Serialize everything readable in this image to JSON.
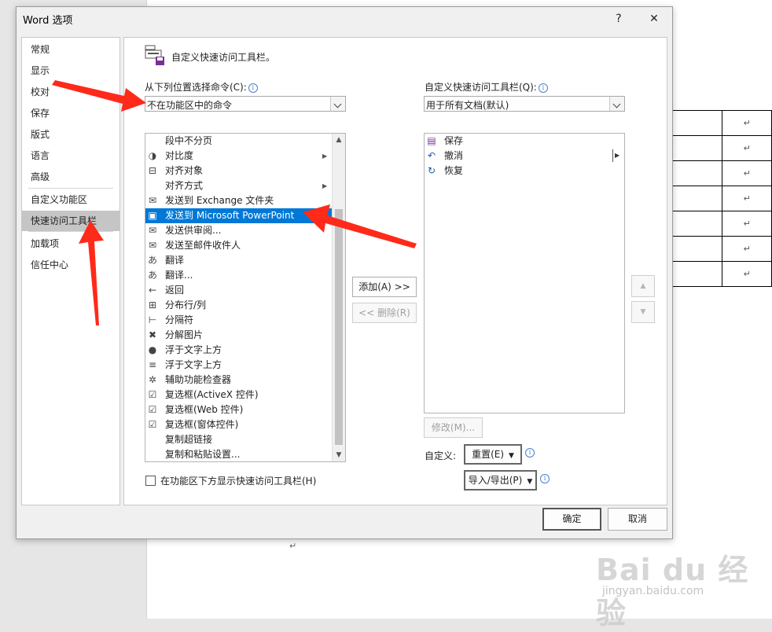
{
  "dialog": {
    "title": "Word 选项",
    "help": "?",
    "close": "✕"
  },
  "nav": {
    "items": [
      {
        "label": "常规"
      },
      {
        "label": "显示"
      },
      {
        "label": "校对"
      },
      {
        "label": "保存"
      },
      {
        "label": "版式"
      },
      {
        "label": "语言"
      },
      {
        "label": "高级"
      },
      {
        "label": "自定义功能区"
      },
      {
        "label": "快速访问工具栏",
        "selected": true
      },
      {
        "label": "加载项"
      },
      {
        "label": "信任中心"
      }
    ]
  },
  "section": {
    "title": "自定义快速访问工具栏。"
  },
  "commands": {
    "label": "从下列位置选择命令(C):",
    "selected": "不在功能区中的命令",
    "items": [
      {
        "label": "段中不分页",
        "icon": ""
      },
      {
        "label": "对比度",
        "icon": "contrast-icon",
        "glyph": "◑",
        "submenu": true
      },
      {
        "label": "对齐对象",
        "icon": "align-objects-icon",
        "glyph": "⊟"
      },
      {
        "label": "对齐方式",
        "icon": "",
        "submenu": true
      },
      {
        "label": "发送到 Exchange 文件夹",
        "icon": "exchange-folder-icon",
        "glyph": "✉"
      },
      {
        "label": "发送到 Microsoft PowerPoint",
        "icon": "powerpoint-icon",
        "glyph": "▣",
        "selected": true
      },
      {
        "label": "发送供审阅...",
        "icon": "send-review-icon",
        "glyph": "✉"
      },
      {
        "label": "发送至邮件收件人",
        "icon": "mail-recipient-icon",
        "glyph": "✉"
      },
      {
        "label": "翻译",
        "icon": "translate-icon",
        "glyph": "あ"
      },
      {
        "label": "翻译...",
        "icon": "translate-icon",
        "glyph": "あ"
      },
      {
        "label": "返回",
        "icon": "back-arrow-icon",
        "glyph": "←"
      },
      {
        "label": "分布行/列",
        "icon": "distribute-icon",
        "glyph": "⊞"
      },
      {
        "label": "分隔符",
        "icon": "separator-icon",
        "glyph": "⊢"
      },
      {
        "label": "分解图片",
        "icon": "ungroup-picture-icon",
        "glyph": "✖"
      },
      {
        "label": "浮于文字上方",
        "icon": "in-front-of-text-icon",
        "glyph": "●"
      },
      {
        "label": "浮于文字上方",
        "icon": "bring-forward-icon",
        "glyph": "≡"
      },
      {
        "label": "辅助功能检查器",
        "icon": "accessibility-icon",
        "glyph": "✲"
      },
      {
        "label": "复选框(ActiveX 控件)",
        "icon": "checkbox-icon",
        "glyph": "☑"
      },
      {
        "label": "复选框(Web 控件)",
        "icon": "checkbox-icon",
        "glyph": "☑"
      },
      {
        "label": "复选框(窗体控件)",
        "icon": "checkbox-icon",
        "glyph": "☑"
      },
      {
        "label": "复制超链接",
        "icon": ""
      },
      {
        "label": "复制和粘贴设置...",
        "icon": ""
      }
    ]
  },
  "toolbar_scope": {
    "label": "自定义快速访问工具栏(Q):",
    "selected": "用于所有文档(默认)"
  },
  "qat": {
    "items": [
      {
        "label": "保存",
        "icon": "save-icon",
        "glyph": "▤"
      },
      {
        "label": "撤消",
        "icon": "undo-icon",
        "glyph": "↶"
      },
      {
        "label": "恢复",
        "icon": "redo-icon",
        "glyph": "↻"
      }
    ]
  },
  "buttons": {
    "add": "添加(A) >>",
    "remove": "<< 删除(R)",
    "modify": "修改(M)...",
    "customize_label": "自定义:",
    "reset": "重置(E)",
    "import_export": "导入/导出(P)",
    "ok": "确定",
    "cancel": "取消"
  },
  "show_below_ribbon": "在功能区下方显示快速访问工具栏(H)",
  "colors": {
    "selection": "#0078d7",
    "annotation_arrow": "#ff2a1a"
  },
  "watermark": {
    "brand": "Bai du 经验",
    "url": "jingyan.baidu.com"
  }
}
